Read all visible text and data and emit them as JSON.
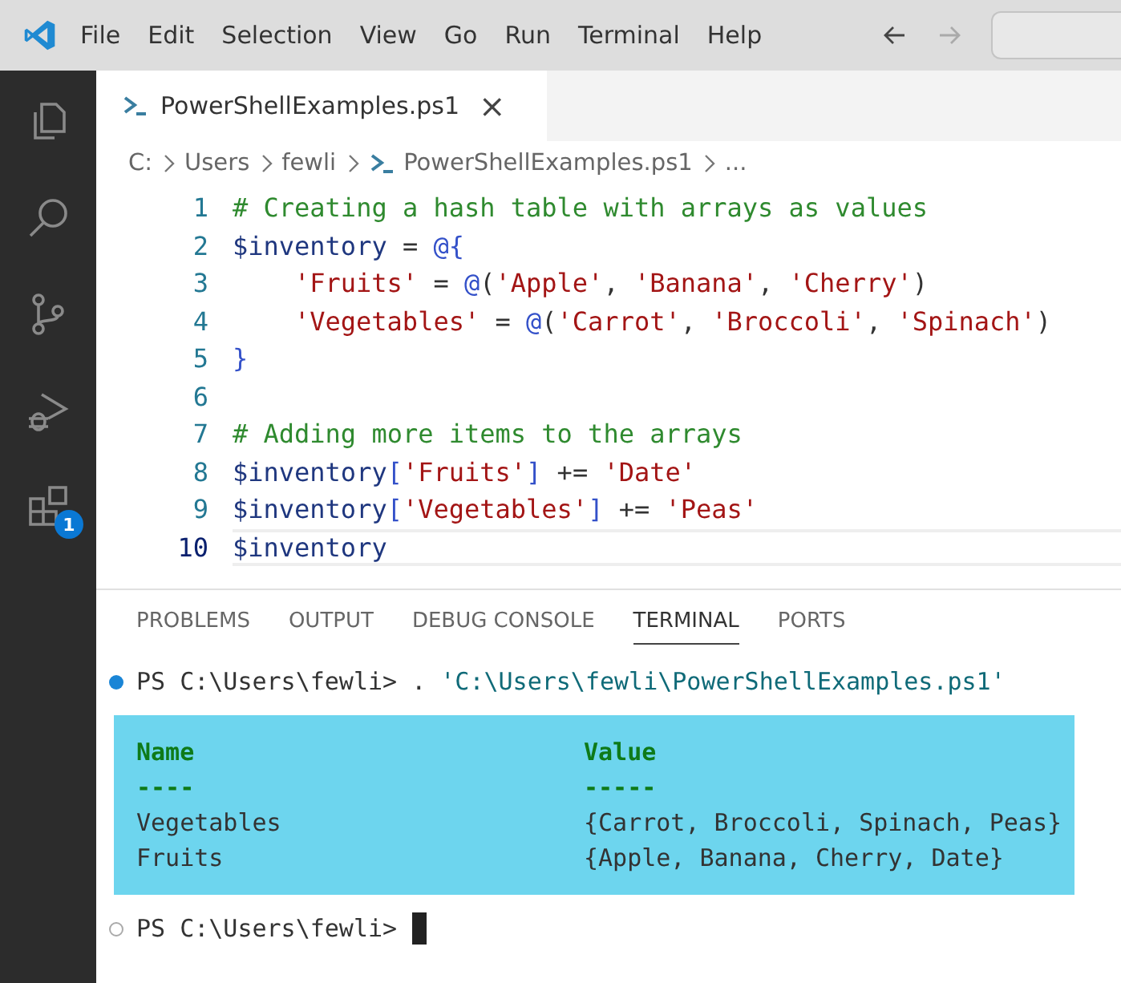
{
  "menu": [
    "File",
    "Edit",
    "Selection",
    "View",
    "Go",
    "Run",
    "Terminal",
    "Help"
  ],
  "activity_bar": [
    {
      "kind": "files",
      "selected": false
    },
    {
      "kind": "search",
      "selected": false
    },
    {
      "kind": "source-control",
      "selected": false
    },
    {
      "kind": "run-debug",
      "selected": false
    },
    {
      "kind": "extensions",
      "selected": false,
      "badge": "1"
    }
  ],
  "editor_tab": {
    "label": "PowerShellExamples.ps1",
    "close": "×"
  },
  "breadcrumbs": [
    "C:",
    "Users",
    "fewli",
    "PowerShellExamples.ps1",
    "..."
  ],
  "code_lines": [
    {
      "number": "1",
      "current": false,
      "tokens": [
        {
          "kind": "comment",
          "text": "# Creating a hash table with arrays as values"
        }
      ]
    },
    {
      "number": "2",
      "current": false,
      "tokens": [
        {
          "kind": "variable",
          "text": "$inventory"
        },
        {
          "kind": "plain",
          "text": " = "
        },
        {
          "kind": "keyword",
          "text": "@{"
        }
      ]
    },
    {
      "number": "3",
      "current": false,
      "indented": true,
      "tokens": [
        {
          "kind": "string",
          "text": "'Fruits'"
        },
        {
          "kind": "plain",
          "text": " = "
        },
        {
          "kind": "keyword",
          "text": "@"
        },
        {
          "kind": "plain",
          "text": "("
        },
        {
          "kind": "string",
          "text": "'Apple'"
        },
        {
          "kind": "plain",
          "text": ", "
        },
        {
          "kind": "string",
          "text": "'Banana'"
        },
        {
          "kind": "plain",
          "text": ", "
        },
        {
          "kind": "string",
          "text": "'Cherry'"
        },
        {
          "kind": "plain",
          "text": ")"
        }
      ]
    },
    {
      "number": "4",
      "current": false,
      "indented": true,
      "tokens": [
        {
          "kind": "string",
          "text": "'Vegetables'"
        },
        {
          "kind": "plain",
          "text": " = "
        },
        {
          "kind": "keyword",
          "text": "@"
        },
        {
          "kind": "plain",
          "text": "("
        },
        {
          "kind": "string",
          "text": "'Carrot'"
        },
        {
          "kind": "plain",
          "text": ", "
        },
        {
          "kind": "string",
          "text": "'Broccoli'"
        },
        {
          "kind": "plain",
          "text": ", "
        },
        {
          "kind": "string",
          "text": "'Spinach'"
        },
        {
          "kind": "plain",
          "text": ")"
        }
      ]
    },
    {
      "number": "5",
      "current": false,
      "tokens": [
        {
          "kind": "keyword",
          "text": "}"
        }
      ]
    },
    {
      "number": "6",
      "current": false
    },
    {
      "number": "7",
      "current": false,
      "tokens": [
        {
          "kind": "comment",
          "text": "# Adding more items to the arrays"
        }
      ]
    },
    {
      "number": "8",
      "current": false,
      "tokens": [
        {
          "kind": "variable",
          "text": "$inventory"
        },
        {
          "kind": "keyword",
          "text": "["
        },
        {
          "kind": "string",
          "text": "'Fruits'"
        },
        {
          "kind": "keyword",
          "text": "]"
        },
        {
          "kind": "plain",
          "text": " += "
        },
        {
          "kind": "string",
          "text": "'Date'"
        }
      ]
    },
    {
      "number": "9",
      "current": false,
      "tokens": [
        {
          "kind": "variable",
          "text": "$inventory"
        },
        {
          "kind": "keyword",
          "text": "["
        },
        {
          "kind": "string",
          "text": "'Vegetables'"
        },
        {
          "kind": "keyword",
          "text": "]"
        },
        {
          "kind": "plain",
          "text": " += "
        },
        {
          "kind": "string",
          "text": "'Peas'"
        }
      ]
    },
    {
      "number": "10",
      "current": true,
      "tokens": [
        {
          "kind": "variable",
          "text": "$inventory"
        }
      ]
    }
  ],
  "panel_tabs": [
    {
      "label": "PROBLEMS",
      "selected": false
    },
    {
      "label": "OUTPUT",
      "selected": false
    },
    {
      "label": "DEBUG CONSOLE",
      "selected": false
    },
    {
      "label": "TERMINAL",
      "selected": true
    },
    {
      "label": "PORTS",
      "selected": false
    }
  ],
  "terminal": {
    "command": {
      "completed": true,
      "prompt": "PS C:\\Users\\fewli>",
      "text": " . ",
      "argument": "'C:\\Users\\fewli\\PowerShellExamples.ps1'"
    },
    "output_table": {
      "columns": [
        "Name",
        "Value"
      ],
      "underlines": [
        "----",
        "-----"
      ],
      "rows": [
        [
          "Vegetables",
          "{Carrot, Broccoli, Spinach, Peas}"
        ],
        [
          "Fruits",
          "{Apple, Banana, Cherry, Date}"
        ]
      ]
    },
    "prompt": {
      "completed": false,
      "text": "PS C:\\Users\\fewli>"
    }
  }
}
